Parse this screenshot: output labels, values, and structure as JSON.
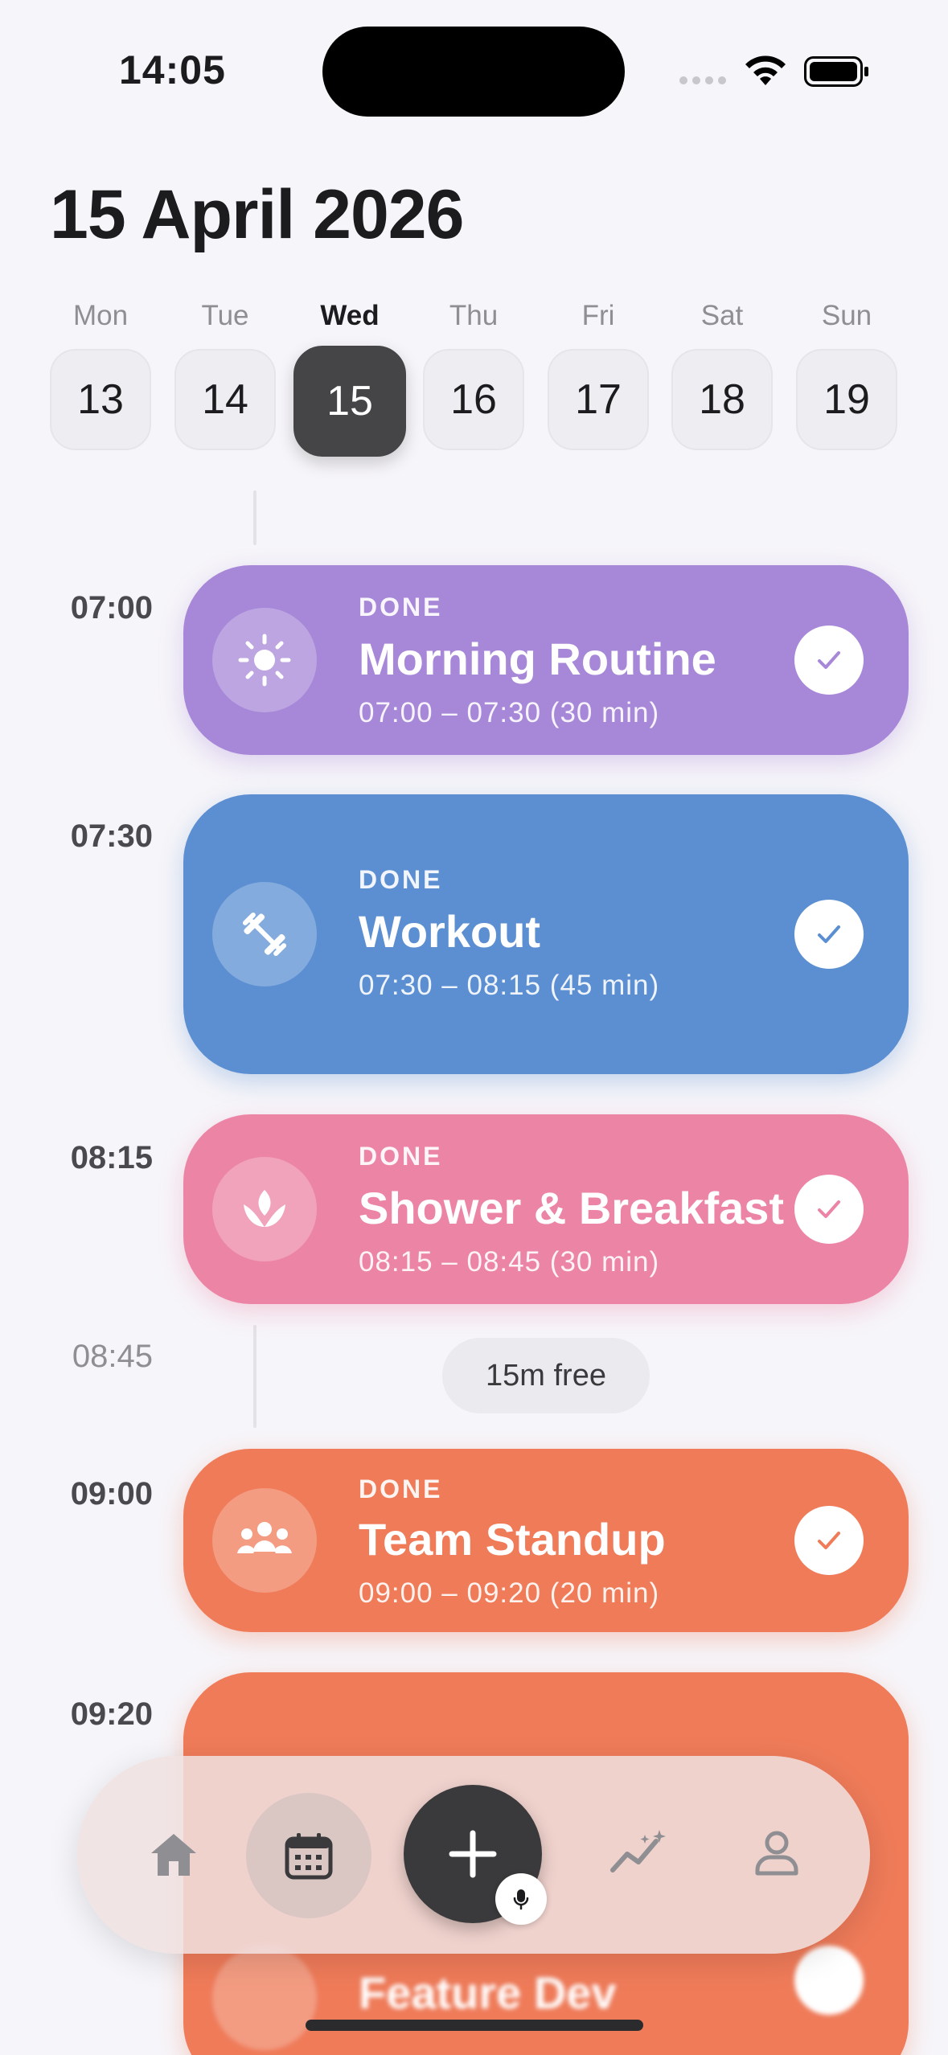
{
  "status_bar": {
    "time": "14:05"
  },
  "header": {
    "title": "15 April 2026"
  },
  "week": [
    {
      "name": "Mon",
      "num": "13",
      "active": false
    },
    {
      "name": "Tue",
      "num": "14",
      "active": false
    },
    {
      "name": "Wed",
      "num": "15",
      "active": true
    },
    {
      "name": "Thu",
      "num": "16",
      "active": false
    },
    {
      "name": "Fri",
      "num": "17",
      "active": false
    },
    {
      "name": "Sat",
      "num": "18",
      "active": false
    },
    {
      "name": "Sun",
      "num": "19",
      "active": false
    }
  ],
  "timeline": {
    "labels": [
      "07:00",
      "07:30",
      "08:15",
      "08:45",
      "09:00",
      "09:20"
    ],
    "free_slot": "15m free"
  },
  "events": [
    {
      "status": "DONE",
      "title": "Morning Routine",
      "time": "07:00 – 07:30 (30 min)",
      "color": "#a787d8",
      "icon": "sun-icon"
    },
    {
      "status": "DONE",
      "title": "Workout",
      "time": "07:30 – 08:15 (45 min)",
      "color": "#5b8fd2",
      "icon": "dumbbell-icon"
    },
    {
      "status": "DONE",
      "title": "Shower & Breakfast",
      "time": "08:15 – 08:45 (30 min)",
      "color": "#ec85a5",
      "icon": "lotus-icon"
    },
    {
      "status": "DONE",
      "title": "Team Standup",
      "time": "09:00 – 09:20 (20 min)",
      "color": "#ef7b59",
      "icon": "team-icon"
    },
    {
      "status": "",
      "title": "Feature Dev",
      "time": "",
      "color": "#ef7b59",
      "icon": "code-icon"
    }
  ],
  "nav": {
    "items": [
      "home-icon",
      "calendar-icon",
      "add-icon",
      "insights-icon",
      "profile-icon"
    ],
    "mic": "mic-icon"
  }
}
